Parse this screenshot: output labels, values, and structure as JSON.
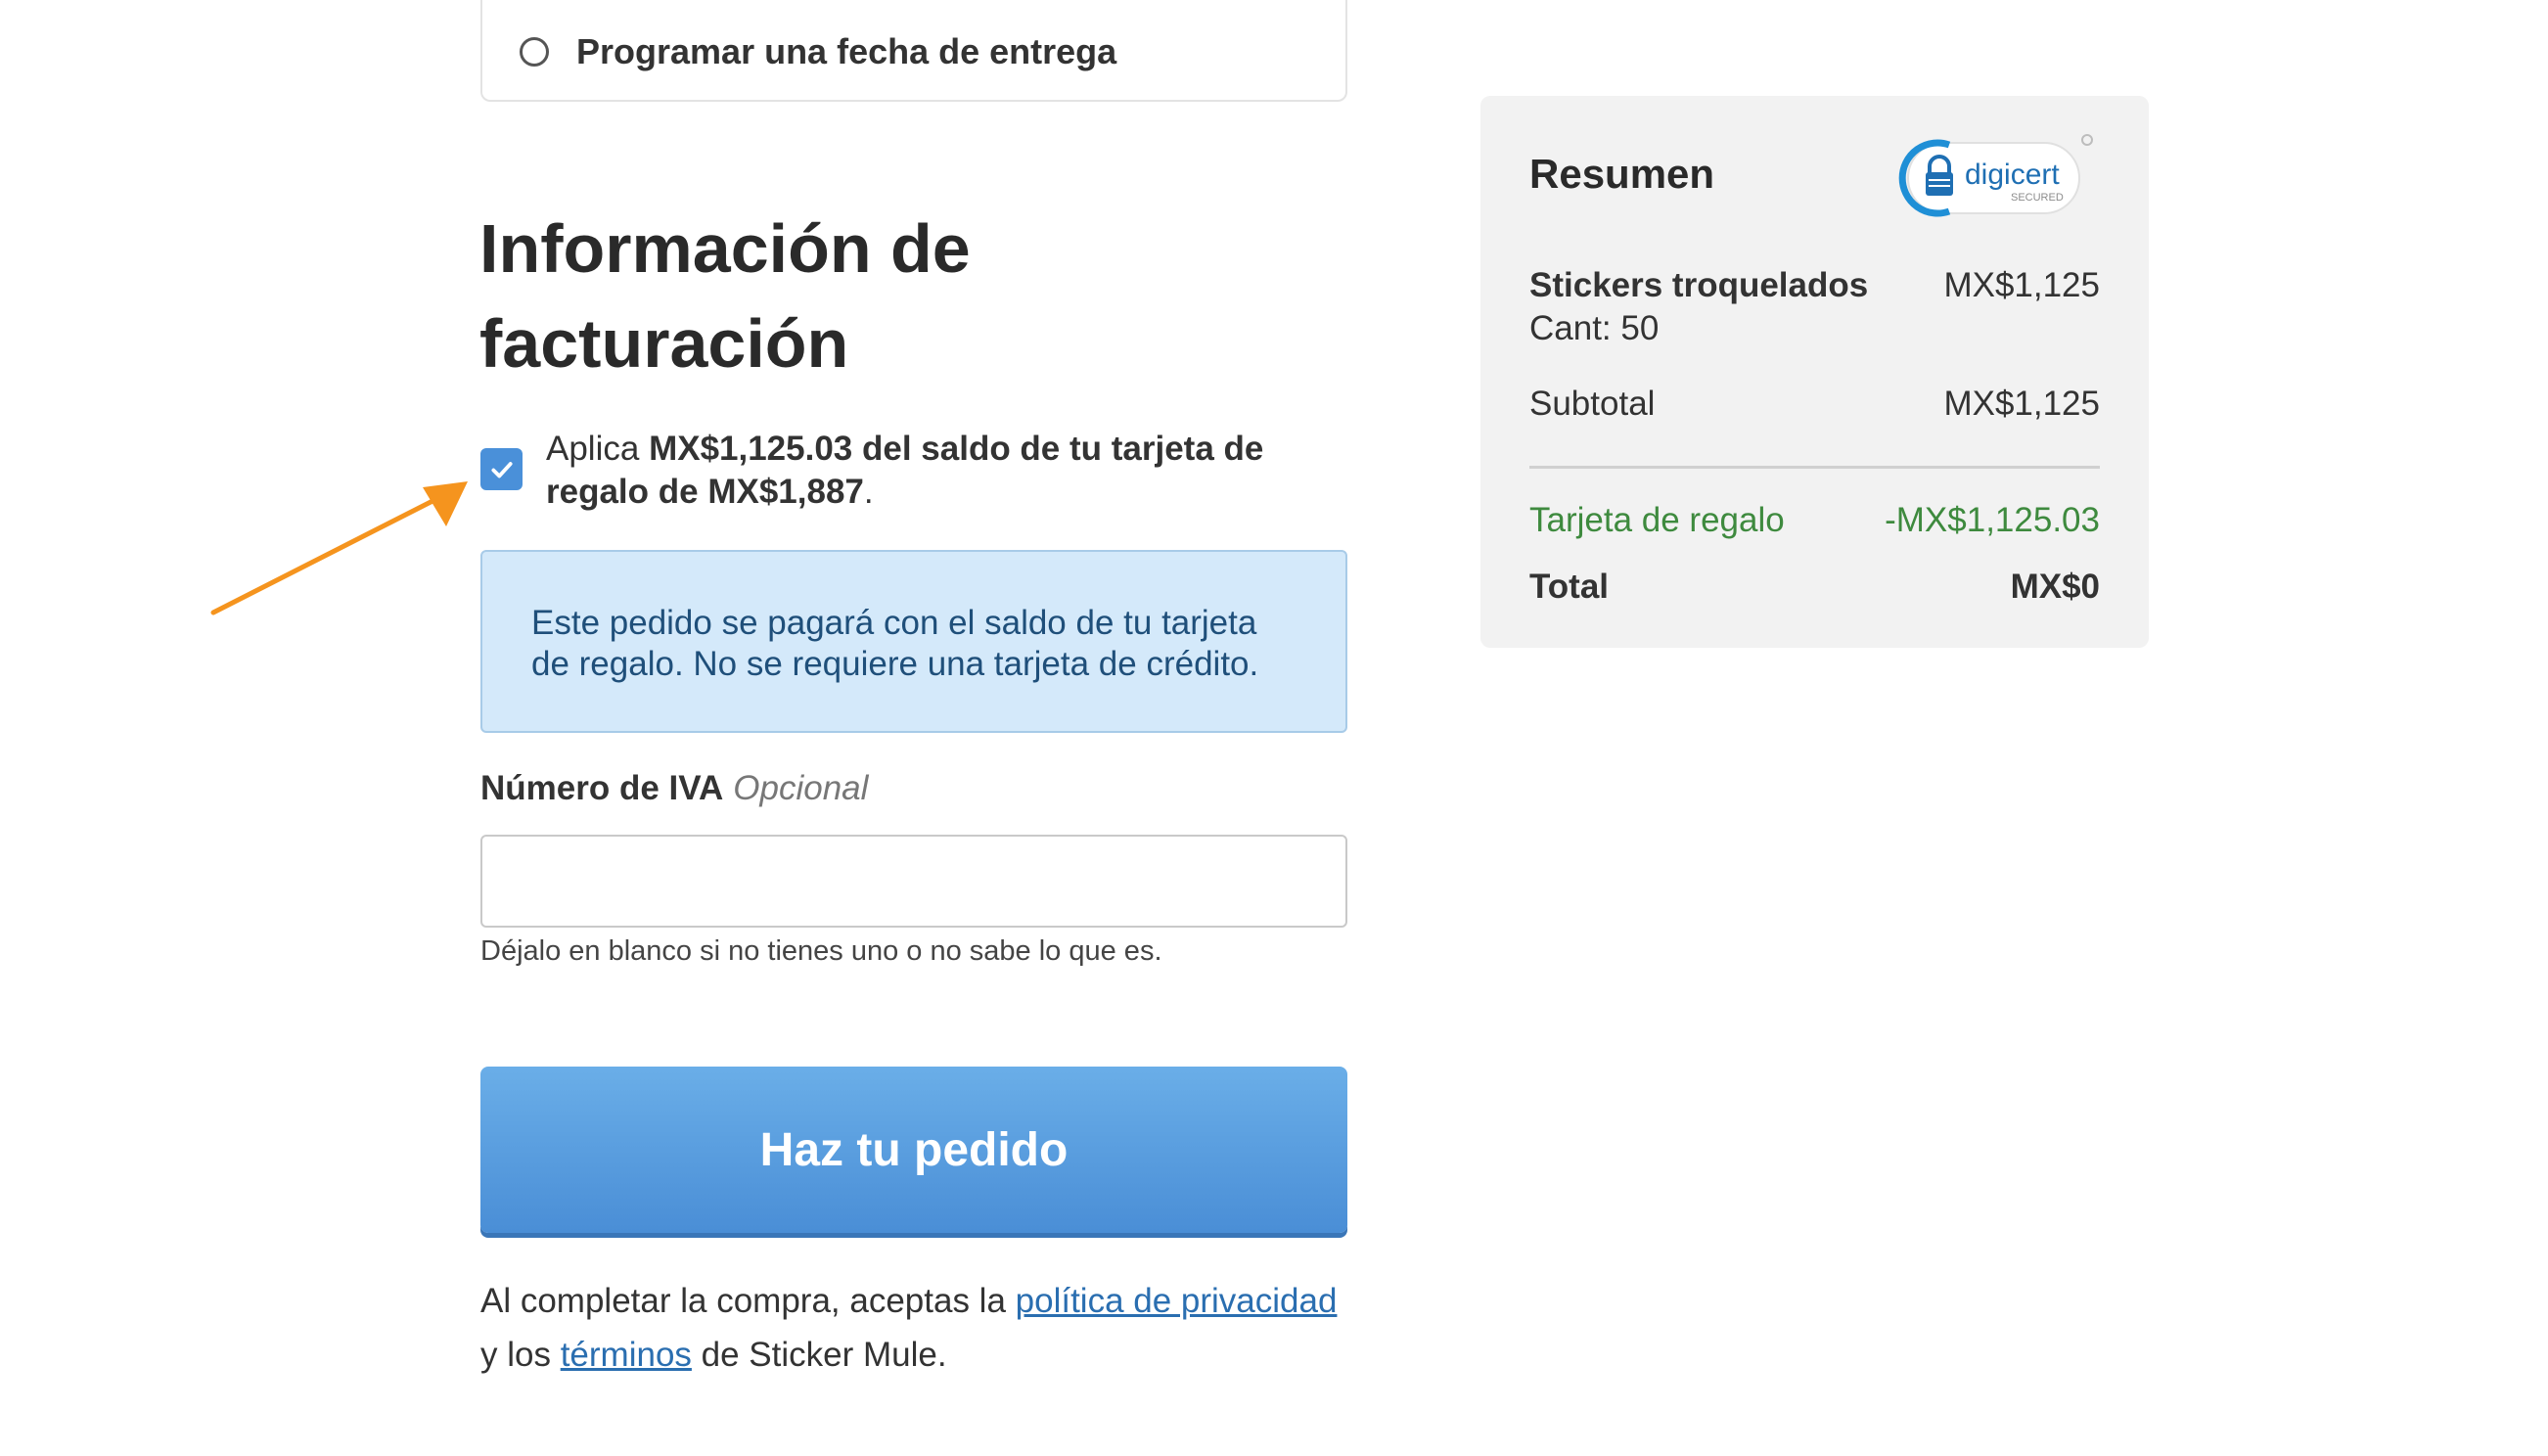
{
  "delivery": {
    "option_label": "Programar una fecha de entrega"
  },
  "billing": {
    "heading_line1": "Información de",
    "heading_line2": "facturación",
    "gift_prefix": "Aplica ",
    "gift_bold_amount": "MX$1,125.03 del saldo de tu tarjeta de regalo de MX$1,887",
    "gift_suffix": ".",
    "gift_checked": true,
    "alert_text": "Este pedido se pagará con el saldo de tu tarjeta de regalo. No se requiere una tarjeta de crédito.",
    "vat_label": "Número de IVA",
    "vat_optional": "Opcional",
    "vat_value": "",
    "vat_help": "Déjalo en blanco si no tienes uno o no sabe lo que es.",
    "submit_label": "Haz tu pedido",
    "legal_prefix": "Al completar la compra, aceptas la ",
    "legal_privacy_link": "política de privacidad",
    "legal_middle": " y los ",
    "legal_terms_link": "términos",
    "legal_suffix": " de Sticker Mule."
  },
  "summary": {
    "title": "Resumen",
    "badge_brand": "digicert",
    "badge_sub": "SECURED",
    "item_name": "Stickers troquelados",
    "item_qty": "Cant: 50",
    "item_price": "MX$1,125",
    "subtotal_label": "Subtotal",
    "subtotal_value": "MX$1,125",
    "gift_label": "Tarjeta de regalo",
    "gift_value": "-MX$1,125.03",
    "total_label": "Total",
    "total_value": "MX$0"
  },
  "colors": {
    "accent_blue": "#4a90d9",
    "alert_bg": "#d4e9fa",
    "gift_green": "#3e8a3e",
    "arrow_orange": "#f5941e"
  },
  "icons": {
    "checkbox_check": "check-icon",
    "annotation": "arrow-icon",
    "security_badge": "lock-icon"
  }
}
